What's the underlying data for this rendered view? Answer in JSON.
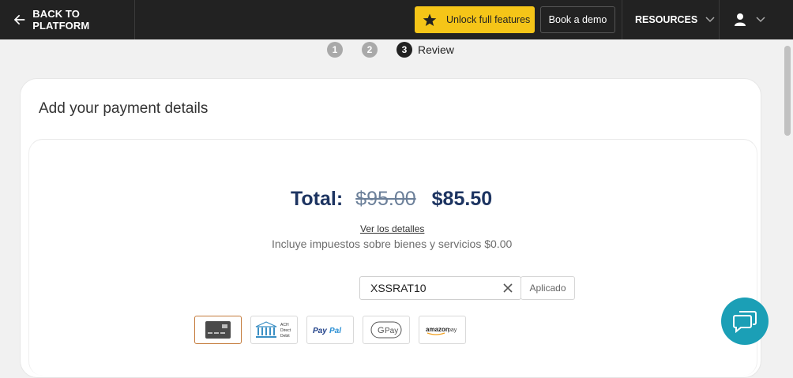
{
  "header": {
    "back_label": "BACK TO PLATFORM",
    "unlock_label": "Unlock full features",
    "demo_label": "Book a demo",
    "resources_label": "RESOURCES"
  },
  "steps": [
    {
      "number": "1",
      "state": "inactive"
    },
    {
      "number": "2",
      "state": "inactive"
    },
    {
      "number": "3",
      "state": "active",
      "label": "Review"
    }
  ],
  "payment": {
    "title": "Add your payment details",
    "total_label": "Total:",
    "original_price": "$95.00",
    "discounted_price": "$85.50",
    "details_link": "Ver los detalles",
    "tax_note": "Incluye impuestos sobre bienes y servicios $0.00",
    "coupon_value": "XSSRAT10",
    "coupon_status": "Aplicado",
    "methods": [
      {
        "icon": "credit-card-icon",
        "selected": true
      },
      {
        "icon": "ach-direct-debit-icon",
        "text": "ACH Direct Debit",
        "selected": false
      },
      {
        "icon": "paypal-icon",
        "text": "PayPal",
        "selected": false
      },
      {
        "icon": "google-pay-icon",
        "text": "G Pay",
        "selected": false
      },
      {
        "icon": "amazon-pay-icon",
        "text": "amazon pay",
        "selected": false
      }
    ]
  },
  "colors": {
    "topbar": "#222222",
    "accent_yellow": "#f5c518",
    "price_blue": "#1d3461",
    "chat_teal": "#1b9fb6",
    "selected_border": "#c47a3a"
  }
}
